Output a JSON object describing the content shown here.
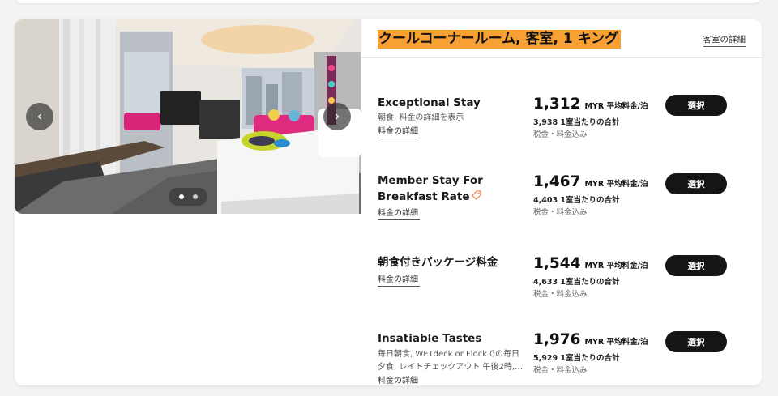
{
  "room": {
    "title": "クールコーナールーム, 客室, 1 キング",
    "details_link": "客室の詳細"
  },
  "carousel": {
    "prev": "‹",
    "next": "›",
    "dot_count": 2,
    "active_dot": 1
  },
  "rates": [
    {
      "name": "Exceptional Stay",
      "description": "朝食, 料金の詳細を表示",
      "details_link": "料金の詳細",
      "price": "1,312",
      "price_unit": "MYR 平均料金/泊",
      "total": "3,938 1室当たりの合計",
      "tax_note": "税金・料金込み",
      "button": "選択"
    },
    {
      "name": "Member Stay For Breakfast Rate",
      "description": "",
      "details_link": "料金の詳細",
      "price": "1,467",
      "price_unit": "MYR 平均料金/泊",
      "total": "4,403 1室当たりの合計",
      "tax_note": "税金・料金込み",
      "button": "選択",
      "icon": "tag-icon"
    },
    {
      "name": "朝食付きパッケージ料金",
      "description": "",
      "details_link": "料金の詳細",
      "price": "1,544",
      "price_unit": "MYR 平均料金/泊",
      "total": "4,633 1室当たりの合計",
      "tax_note": "税金・料金込み",
      "button": "選択"
    },
    {
      "name": "Insatiable Tastes",
      "description": "毎日朝食, WETdeck or Flockでの毎日夕食, レイトチェックアウト 午後2時,…",
      "details_link": "料金の詳細",
      "price": "1,976",
      "price_unit": "MYR 平均料金/泊",
      "total": "5,929 1室当たりの合計",
      "tax_note": "税金・料金込み",
      "button": "選択"
    }
  ],
  "colors": {
    "title_highlight": "#f7a135",
    "button_bg": "#151515",
    "accent_pink": "#e0307a"
  }
}
